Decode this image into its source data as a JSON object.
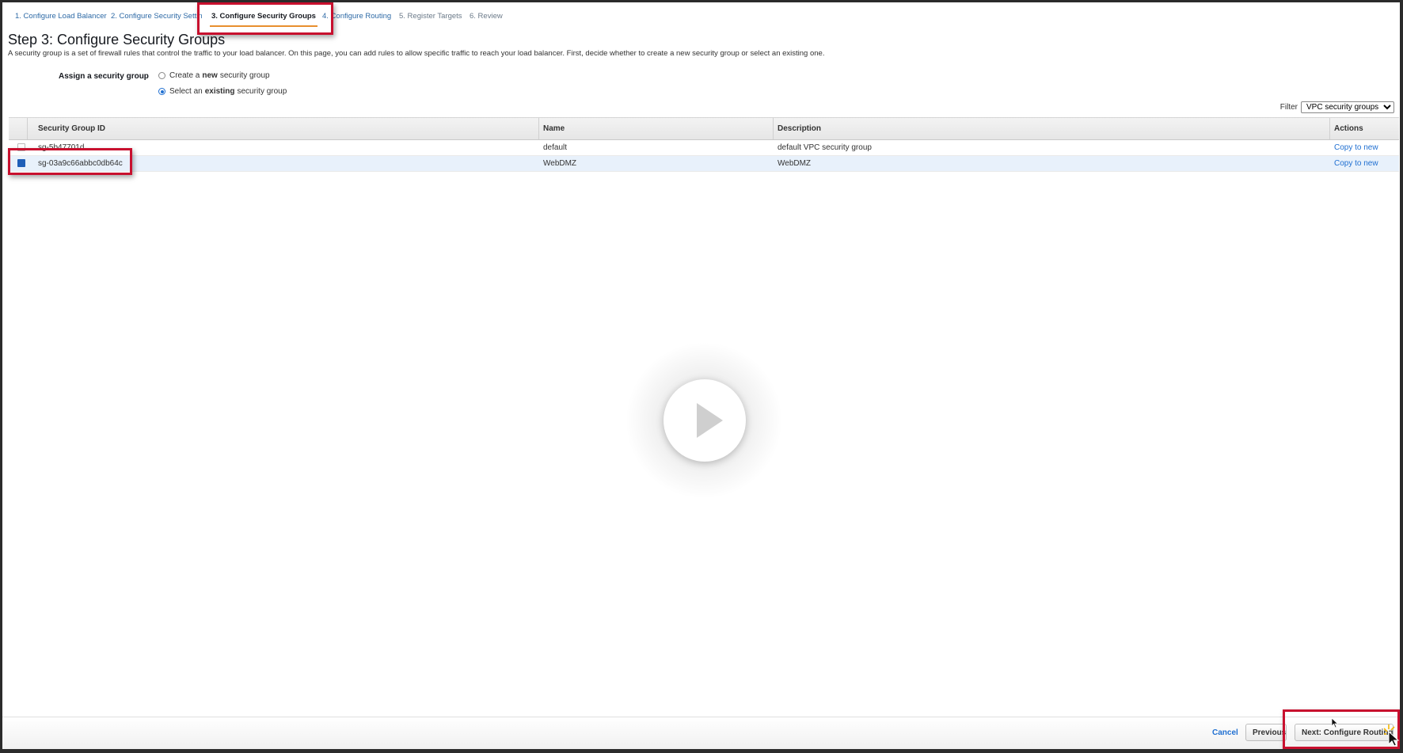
{
  "wizard": {
    "tabs": [
      {
        "label": "1. Configure Load Balancer"
      },
      {
        "label": "2. Configure Security Settings"
      },
      {
        "label": "3. Configure Security Groups"
      },
      {
        "label": "4. Configure Routing"
      },
      {
        "label": "5. Register Targets"
      },
      {
        "label": "6. Review"
      }
    ],
    "active_index": 2
  },
  "page": {
    "title": "Step 3: Configure Security Groups",
    "description": "A security group is a set of firewall rules that control the traffic to your load balancer. On this page, you can add rules to allow specific traffic to reach your load balancer. First, decide whether to create a new security group or select an existing one."
  },
  "assign": {
    "label": "Assign a security group",
    "option_new": {
      "prefix": "Create a",
      "bold": "new",
      "suffix": "security group",
      "checked": false
    },
    "option_existing": {
      "prefix": "Select an",
      "bold": "existing",
      "suffix": "security group",
      "checked": true
    }
  },
  "filter": {
    "label": "Filter",
    "selected": "VPC security groups"
  },
  "table": {
    "columns": [
      "Security Group ID",
      "Name",
      "Description",
      "Actions"
    ],
    "rows": [
      {
        "id": "sg-5b47701d",
        "name": "default",
        "description": "default VPC security group",
        "action": "Copy to new",
        "checked": false
      },
      {
        "id": "sg-03a9c66abbc0db64c",
        "name": "WebDMZ",
        "description": "WebDMZ",
        "action": "Copy to new",
        "checked": true
      }
    ]
  },
  "footer": {
    "cancel": "Cancel",
    "previous": "Previous",
    "next": "Next: Configure Routing"
  },
  "colors": {
    "highlight": "#c8102e",
    "link": "#1f6fd1",
    "active_tab_underline": "#e88f2e",
    "selected_row": "#e8f1fb"
  },
  "icons": {
    "play": "play-icon",
    "cursor": "mouse-pointer-icon"
  }
}
